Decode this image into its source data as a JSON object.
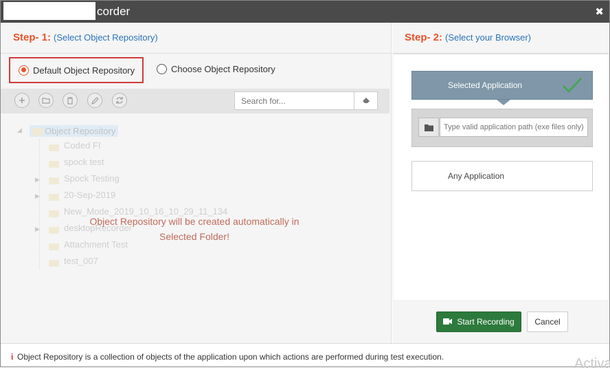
{
  "window": {
    "title": "corder",
    "close_glyph": "✖"
  },
  "step1": {
    "label": "Step- 1:",
    "description": "(Select Object Repository)",
    "radio_default": "Default Object Repository",
    "radio_choose": "Choose Object Repository",
    "search_placeholder": "Search for...",
    "tree_root": "Object Repository",
    "tree_items": [
      "Coded FI",
      "spock test",
      "Spock Testing",
      "20-Sep-2019",
      "New_Mode_2019_10_16_10_29_11_134",
      "desktopRecorder",
      "Attachment Test",
      "test_007"
    ],
    "overlay_line1": "Object Repository will be created automatically in",
    "overlay_line2": "Selected Folder!"
  },
  "step2": {
    "label": "Step- 2:",
    "description": "(Select your Browser)",
    "selected_application": "Selected Application",
    "path_placeholder": "Type valid application path (exe files only)",
    "any_application": "Any Application"
  },
  "buttons": {
    "start_recording": "Start Recording",
    "cancel": "Cancel"
  },
  "footer": {
    "info_icon": "i",
    "text": "Object Repository is a collection of objects of the application upon which actions are performed during test execution."
  },
  "watermark": "Activa",
  "colors": {
    "step_number": "#e5532a",
    "step_desc": "#2b74b8",
    "selected_bg": "#7f97a8",
    "start_button": "#2c7a3c",
    "highlight_border": "#d23a3a"
  }
}
